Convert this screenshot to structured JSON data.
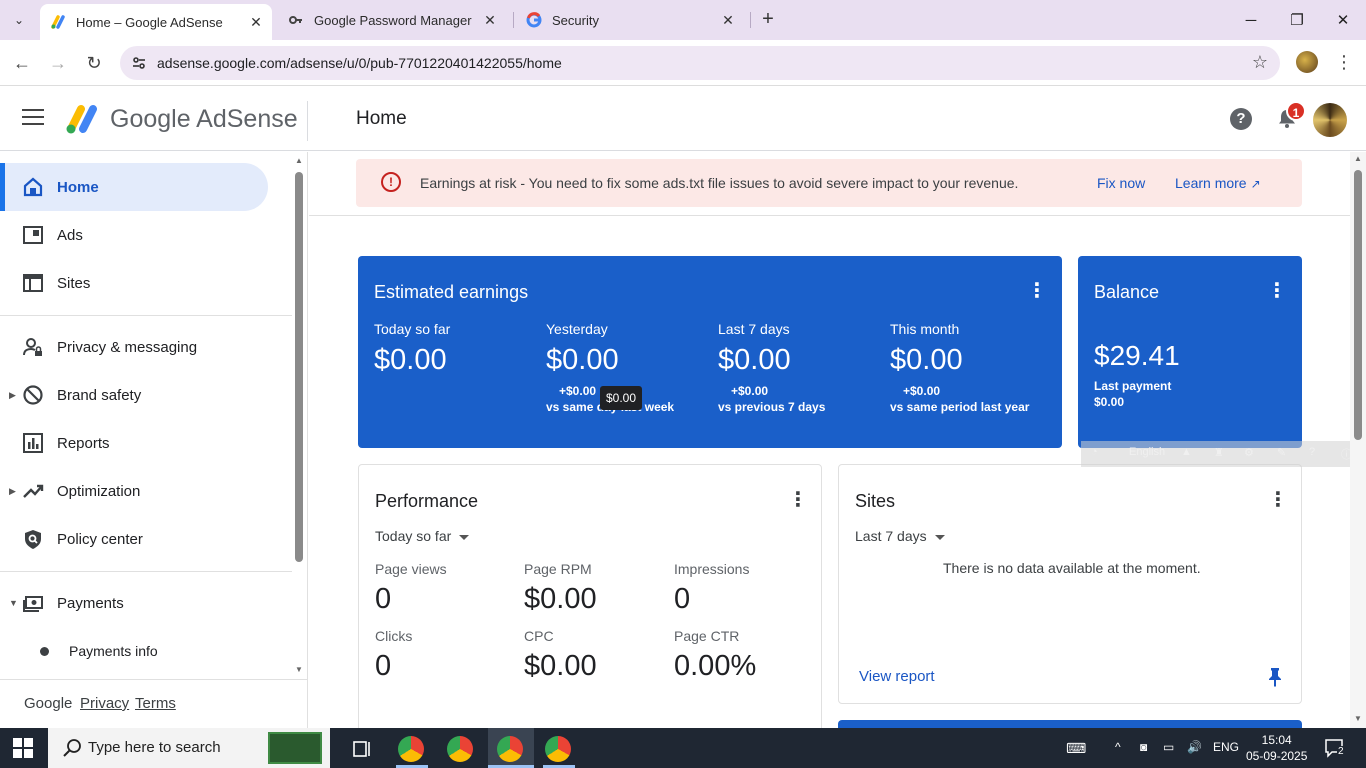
{
  "browser": {
    "tabs": [
      {
        "title": "Home – Google AdSense",
        "active": true
      },
      {
        "title": "Google Password Manager",
        "active": false
      },
      {
        "title": "Security",
        "active": false
      }
    ],
    "url": "adsense.google.com/adsense/u/0/pub-7701220401422055/home"
  },
  "header": {
    "brand": "Google AdSense",
    "page_title": "Home",
    "help_label": "?",
    "notification_count": "1"
  },
  "sidebar": {
    "items": [
      {
        "label": "Home",
        "icon": "home-icon",
        "active": true
      },
      {
        "label": "Ads",
        "icon": "ads-icon"
      },
      {
        "label": "Sites",
        "icon": "sites-icon"
      },
      {
        "label": "Privacy & messaging",
        "icon": "privacy-icon"
      },
      {
        "label": "Brand safety",
        "icon": "block-icon",
        "expandable": true
      },
      {
        "label": "Reports",
        "icon": "reports-icon"
      },
      {
        "label": "Optimization",
        "icon": "trending-icon",
        "expandable": true
      },
      {
        "label": "Policy center",
        "icon": "policy-icon"
      },
      {
        "label": "Payments",
        "icon": "payments-icon",
        "expanded": true
      }
    ],
    "subitems": [
      {
        "label": "Payments info"
      }
    ],
    "footer": {
      "google": "Google",
      "privacy": "Privacy",
      "terms": "Terms"
    }
  },
  "alert": {
    "icon": "!",
    "text": "Earnings at risk - You need to fix some ads.txt file issues to avoid severe impact to your revenue.",
    "fix_label": "Fix now",
    "learn_label": "Learn more"
  },
  "earnings": {
    "title": "Estimated earnings",
    "metrics": [
      {
        "label": "Today so far",
        "value": "$0.00",
        "delta": "",
        "compare": ""
      },
      {
        "label": "Yesterday",
        "value": "$0.00",
        "delta": "+$0.00",
        "compare": "vs same day last week"
      },
      {
        "label": "Last 7 days",
        "value": "$0.00",
        "delta": "+$0.00",
        "compare": "vs previous 7 days"
      },
      {
        "label": "This month",
        "value": "$0.00",
        "delta": "+$0.00",
        "compare": "vs same period last year"
      }
    ],
    "tooltip": "$0.00"
  },
  "balance": {
    "title": "Balance",
    "value": "$29.41",
    "last_payment_label": "Last payment",
    "last_payment_value": "$0.00"
  },
  "performance": {
    "title": "Performance",
    "range": "Today so far",
    "metrics": [
      {
        "label": "Page views",
        "value": "0"
      },
      {
        "label": "Page RPM",
        "value": "$0.00"
      },
      {
        "label": "Impressions",
        "value": "0"
      },
      {
        "label": "Clicks",
        "value": "0"
      },
      {
        "label": "CPC",
        "value": "$0.00"
      },
      {
        "label": "Page CTR",
        "value": "0.00%"
      }
    ]
  },
  "sites": {
    "title": "Sites",
    "range": "Last 7 days",
    "empty_message": "There is no data available at the moment.",
    "view_report": "View report"
  },
  "ime": {
    "language": "English"
  },
  "taskbar": {
    "search_placeholder": "Type here to search",
    "language": "ENG",
    "time": "15:04",
    "date": "05-09-2025",
    "notification_count": "2"
  },
  "colors": {
    "accent": "#1a5fc9",
    "alert_bg": "#fce8e6",
    "link": "#1a56c4"
  }
}
